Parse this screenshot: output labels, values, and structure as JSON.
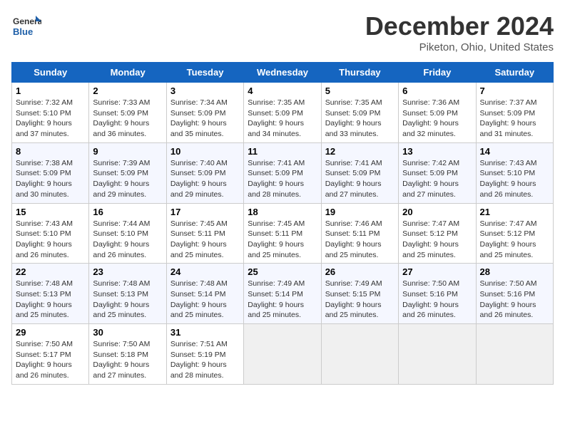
{
  "logo": {
    "line1": "General",
    "line2": "Blue"
  },
  "header": {
    "month": "December 2024",
    "location": "Piketon, Ohio, United States"
  },
  "days_of_week": [
    "Sunday",
    "Monday",
    "Tuesday",
    "Wednesday",
    "Thursday",
    "Friday",
    "Saturday"
  ],
  "weeks": [
    [
      {
        "day": "1",
        "sunrise": "7:32 AM",
        "sunset": "5:10 PM",
        "daylight": "9 hours and 37 minutes."
      },
      {
        "day": "2",
        "sunrise": "7:33 AM",
        "sunset": "5:09 PM",
        "daylight": "9 hours and 36 minutes."
      },
      {
        "day": "3",
        "sunrise": "7:34 AM",
        "sunset": "5:09 PM",
        "daylight": "9 hours and 35 minutes."
      },
      {
        "day": "4",
        "sunrise": "7:35 AM",
        "sunset": "5:09 PM",
        "daylight": "9 hours and 34 minutes."
      },
      {
        "day": "5",
        "sunrise": "7:35 AM",
        "sunset": "5:09 PM",
        "daylight": "9 hours and 33 minutes."
      },
      {
        "day": "6",
        "sunrise": "7:36 AM",
        "sunset": "5:09 PM",
        "daylight": "9 hours and 32 minutes."
      },
      {
        "day": "7",
        "sunrise": "7:37 AM",
        "sunset": "5:09 PM",
        "daylight": "9 hours and 31 minutes."
      }
    ],
    [
      {
        "day": "8",
        "sunrise": "7:38 AM",
        "sunset": "5:09 PM",
        "daylight": "9 hours and 30 minutes."
      },
      {
        "day": "9",
        "sunrise": "7:39 AM",
        "sunset": "5:09 PM",
        "daylight": "9 hours and 29 minutes."
      },
      {
        "day": "10",
        "sunrise": "7:40 AM",
        "sunset": "5:09 PM",
        "daylight": "9 hours and 29 minutes."
      },
      {
        "day": "11",
        "sunrise": "7:41 AM",
        "sunset": "5:09 PM",
        "daylight": "9 hours and 28 minutes."
      },
      {
        "day": "12",
        "sunrise": "7:41 AM",
        "sunset": "5:09 PM",
        "daylight": "9 hours and 27 minutes."
      },
      {
        "day": "13",
        "sunrise": "7:42 AM",
        "sunset": "5:09 PM",
        "daylight": "9 hours and 27 minutes."
      },
      {
        "day": "14",
        "sunrise": "7:43 AM",
        "sunset": "5:10 PM",
        "daylight": "9 hours and 26 minutes."
      }
    ],
    [
      {
        "day": "15",
        "sunrise": "7:43 AM",
        "sunset": "5:10 PM",
        "daylight": "9 hours and 26 minutes."
      },
      {
        "day": "16",
        "sunrise": "7:44 AM",
        "sunset": "5:10 PM",
        "daylight": "9 hours and 26 minutes."
      },
      {
        "day": "17",
        "sunrise": "7:45 AM",
        "sunset": "5:11 PM",
        "daylight": "9 hours and 25 minutes."
      },
      {
        "day": "18",
        "sunrise": "7:45 AM",
        "sunset": "5:11 PM",
        "daylight": "9 hours and 25 minutes."
      },
      {
        "day": "19",
        "sunrise": "7:46 AM",
        "sunset": "5:11 PM",
        "daylight": "9 hours and 25 minutes."
      },
      {
        "day": "20",
        "sunrise": "7:47 AM",
        "sunset": "5:12 PM",
        "daylight": "9 hours and 25 minutes."
      },
      {
        "day": "21",
        "sunrise": "7:47 AM",
        "sunset": "5:12 PM",
        "daylight": "9 hours and 25 minutes."
      }
    ],
    [
      {
        "day": "22",
        "sunrise": "7:48 AM",
        "sunset": "5:13 PM",
        "daylight": "9 hours and 25 minutes."
      },
      {
        "day": "23",
        "sunrise": "7:48 AM",
        "sunset": "5:13 PM",
        "daylight": "9 hours and 25 minutes."
      },
      {
        "day": "24",
        "sunrise": "7:48 AM",
        "sunset": "5:14 PM",
        "daylight": "9 hours and 25 minutes."
      },
      {
        "day": "25",
        "sunrise": "7:49 AM",
        "sunset": "5:14 PM",
        "daylight": "9 hours and 25 minutes."
      },
      {
        "day": "26",
        "sunrise": "7:49 AM",
        "sunset": "5:15 PM",
        "daylight": "9 hours and 25 minutes."
      },
      {
        "day": "27",
        "sunrise": "7:50 AM",
        "sunset": "5:16 PM",
        "daylight": "9 hours and 26 minutes."
      },
      {
        "day": "28",
        "sunrise": "7:50 AM",
        "sunset": "5:16 PM",
        "daylight": "9 hours and 26 minutes."
      }
    ],
    [
      {
        "day": "29",
        "sunrise": "7:50 AM",
        "sunset": "5:17 PM",
        "daylight": "9 hours and 26 minutes."
      },
      {
        "day": "30",
        "sunrise": "7:50 AM",
        "sunset": "5:18 PM",
        "daylight": "9 hours and 27 minutes."
      },
      {
        "day": "31",
        "sunrise": "7:51 AM",
        "sunset": "5:19 PM",
        "daylight": "9 hours and 28 minutes."
      },
      null,
      null,
      null,
      null
    ]
  ]
}
